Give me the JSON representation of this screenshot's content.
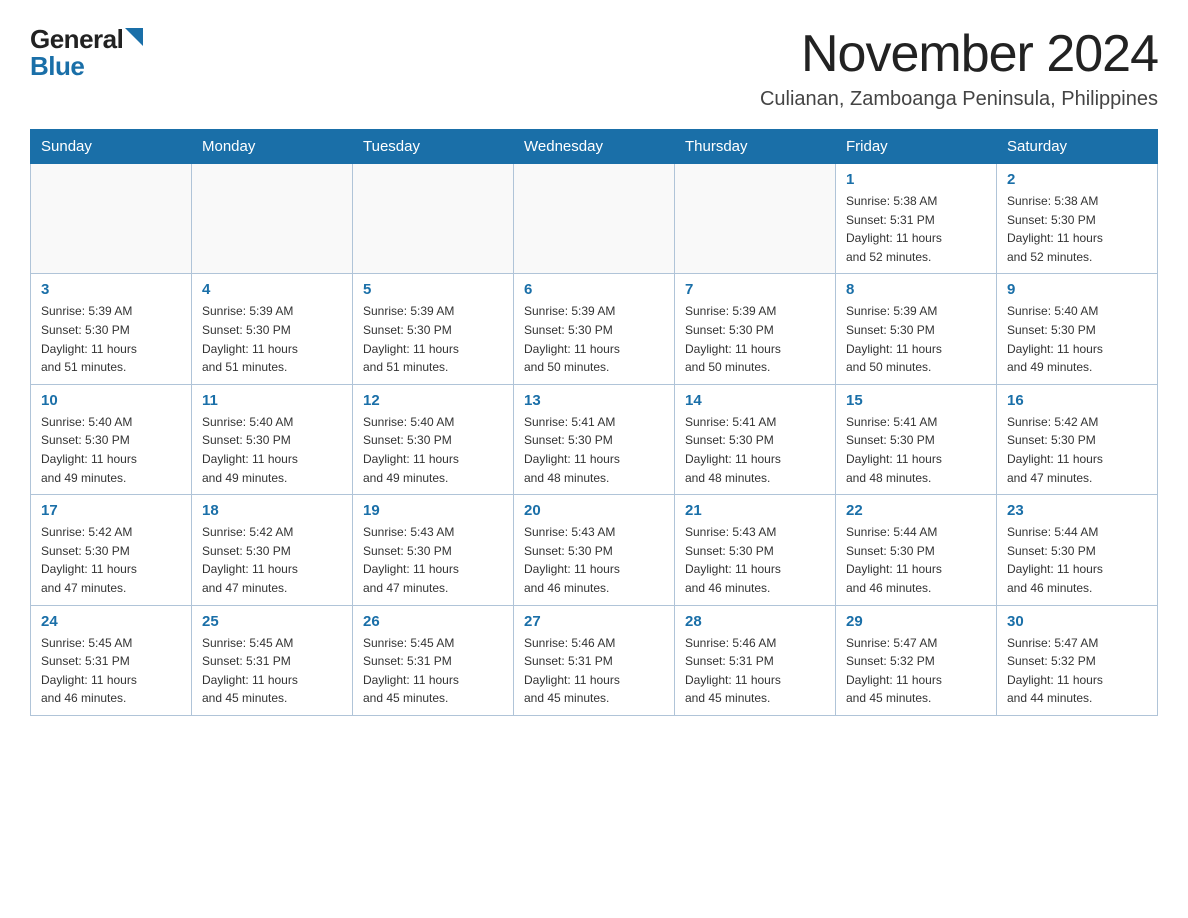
{
  "logo": {
    "general": "General",
    "blue": "Blue"
  },
  "header": {
    "month": "November 2024",
    "location": "Culianan, Zamboanga Peninsula, Philippines"
  },
  "days_of_week": [
    "Sunday",
    "Monday",
    "Tuesday",
    "Wednesday",
    "Thursday",
    "Friday",
    "Saturday"
  ],
  "weeks": [
    [
      {
        "day": "",
        "info": ""
      },
      {
        "day": "",
        "info": ""
      },
      {
        "day": "",
        "info": ""
      },
      {
        "day": "",
        "info": ""
      },
      {
        "day": "",
        "info": ""
      },
      {
        "day": "1",
        "info": "Sunrise: 5:38 AM\nSunset: 5:31 PM\nDaylight: 11 hours\nand 52 minutes."
      },
      {
        "day": "2",
        "info": "Sunrise: 5:38 AM\nSunset: 5:30 PM\nDaylight: 11 hours\nand 52 minutes."
      }
    ],
    [
      {
        "day": "3",
        "info": "Sunrise: 5:39 AM\nSunset: 5:30 PM\nDaylight: 11 hours\nand 51 minutes."
      },
      {
        "day": "4",
        "info": "Sunrise: 5:39 AM\nSunset: 5:30 PM\nDaylight: 11 hours\nand 51 minutes."
      },
      {
        "day": "5",
        "info": "Sunrise: 5:39 AM\nSunset: 5:30 PM\nDaylight: 11 hours\nand 51 minutes."
      },
      {
        "day": "6",
        "info": "Sunrise: 5:39 AM\nSunset: 5:30 PM\nDaylight: 11 hours\nand 50 minutes."
      },
      {
        "day": "7",
        "info": "Sunrise: 5:39 AM\nSunset: 5:30 PM\nDaylight: 11 hours\nand 50 minutes."
      },
      {
        "day": "8",
        "info": "Sunrise: 5:39 AM\nSunset: 5:30 PM\nDaylight: 11 hours\nand 50 minutes."
      },
      {
        "day": "9",
        "info": "Sunrise: 5:40 AM\nSunset: 5:30 PM\nDaylight: 11 hours\nand 49 minutes."
      }
    ],
    [
      {
        "day": "10",
        "info": "Sunrise: 5:40 AM\nSunset: 5:30 PM\nDaylight: 11 hours\nand 49 minutes."
      },
      {
        "day": "11",
        "info": "Sunrise: 5:40 AM\nSunset: 5:30 PM\nDaylight: 11 hours\nand 49 minutes."
      },
      {
        "day": "12",
        "info": "Sunrise: 5:40 AM\nSunset: 5:30 PM\nDaylight: 11 hours\nand 49 minutes."
      },
      {
        "day": "13",
        "info": "Sunrise: 5:41 AM\nSunset: 5:30 PM\nDaylight: 11 hours\nand 48 minutes."
      },
      {
        "day": "14",
        "info": "Sunrise: 5:41 AM\nSunset: 5:30 PM\nDaylight: 11 hours\nand 48 minutes."
      },
      {
        "day": "15",
        "info": "Sunrise: 5:41 AM\nSunset: 5:30 PM\nDaylight: 11 hours\nand 48 minutes."
      },
      {
        "day": "16",
        "info": "Sunrise: 5:42 AM\nSunset: 5:30 PM\nDaylight: 11 hours\nand 47 minutes."
      }
    ],
    [
      {
        "day": "17",
        "info": "Sunrise: 5:42 AM\nSunset: 5:30 PM\nDaylight: 11 hours\nand 47 minutes."
      },
      {
        "day": "18",
        "info": "Sunrise: 5:42 AM\nSunset: 5:30 PM\nDaylight: 11 hours\nand 47 minutes."
      },
      {
        "day": "19",
        "info": "Sunrise: 5:43 AM\nSunset: 5:30 PM\nDaylight: 11 hours\nand 47 minutes."
      },
      {
        "day": "20",
        "info": "Sunrise: 5:43 AM\nSunset: 5:30 PM\nDaylight: 11 hours\nand 46 minutes."
      },
      {
        "day": "21",
        "info": "Sunrise: 5:43 AM\nSunset: 5:30 PM\nDaylight: 11 hours\nand 46 minutes."
      },
      {
        "day": "22",
        "info": "Sunrise: 5:44 AM\nSunset: 5:30 PM\nDaylight: 11 hours\nand 46 minutes."
      },
      {
        "day": "23",
        "info": "Sunrise: 5:44 AM\nSunset: 5:30 PM\nDaylight: 11 hours\nand 46 minutes."
      }
    ],
    [
      {
        "day": "24",
        "info": "Sunrise: 5:45 AM\nSunset: 5:31 PM\nDaylight: 11 hours\nand 46 minutes."
      },
      {
        "day": "25",
        "info": "Sunrise: 5:45 AM\nSunset: 5:31 PM\nDaylight: 11 hours\nand 45 minutes."
      },
      {
        "day": "26",
        "info": "Sunrise: 5:45 AM\nSunset: 5:31 PM\nDaylight: 11 hours\nand 45 minutes."
      },
      {
        "day": "27",
        "info": "Sunrise: 5:46 AM\nSunset: 5:31 PM\nDaylight: 11 hours\nand 45 minutes."
      },
      {
        "day": "28",
        "info": "Sunrise: 5:46 AM\nSunset: 5:31 PM\nDaylight: 11 hours\nand 45 minutes."
      },
      {
        "day": "29",
        "info": "Sunrise: 5:47 AM\nSunset: 5:32 PM\nDaylight: 11 hours\nand 45 minutes."
      },
      {
        "day": "30",
        "info": "Sunrise: 5:47 AM\nSunset: 5:32 PM\nDaylight: 11 hours\nand 44 minutes."
      }
    ]
  ]
}
